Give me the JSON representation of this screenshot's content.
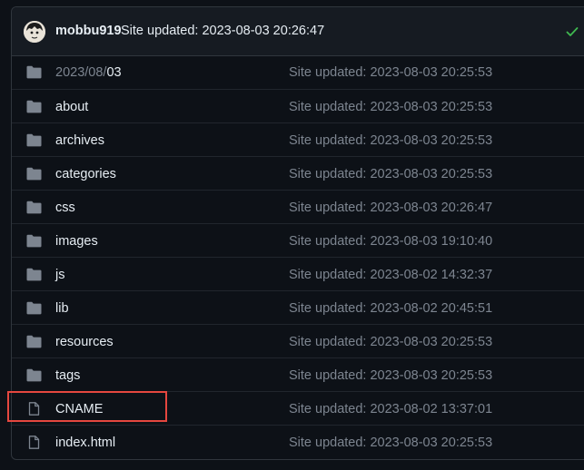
{
  "commit_header": {
    "author": "mobbu919",
    "message": "Site updated: 2023-08-03 20:26:47",
    "status_icon": "check-icon",
    "status_color": "#3fb950"
  },
  "path_row": {
    "prefix": "2023/08/",
    "current": "03",
    "commit": "Site updated: 2023-08-03 20:25:53"
  },
  "files": [
    {
      "type": "folder",
      "name": "about",
      "commit": "Site updated: 2023-08-03 20:25:53"
    },
    {
      "type": "folder",
      "name": "archives",
      "commit": "Site updated: 2023-08-03 20:25:53"
    },
    {
      "type": "folder",
      "name": "categories",
      "commit": "Site updated: 2023-08-03 20:25:53"
    },
    {
      "type": "folder",
      "name": "css",
      "commit": "Site updated: 2023-08-03 20:26:47"
    },
    {
      "type": "folder",
      "name": "images",
      "commit": "Site updated: 2023-08-03 19:10:40"
    },
    {
      "type": "folder",
      "name": "js",
      "commit": "Site updated: 2023-08-02 14:32:37"
    },
    {
      "type": "folder",
      "name": "lib",
      "commit": "Site updated: 2023-08-02 20:45:51"
    },
    {
      "type": "folder",
      "name": "resources",
      "commit": "Site updated: 2023-08-03 20:25:53"
    },
    {
      "type": "folder",
      "name": "tags",
      "commit": "Site updated: 2023-08-03 20:25:53"
    },
    {
      "type": "file",
      "name": "CNAME",
      "commit": "Site updated: 2023-08-02 13:37:01"
    },
    {
      "type": "file",
      "name": "index.html",
      "commit": "Site updated: 2023-08-03 20:25:53"
    }
  ],
  "colors": {
    "background": "#0d1117",
    "header_bg": "#161b22",
    "folder_icon": "#7d8590",
    "highlight_border": "#e5473f"
  }
}
